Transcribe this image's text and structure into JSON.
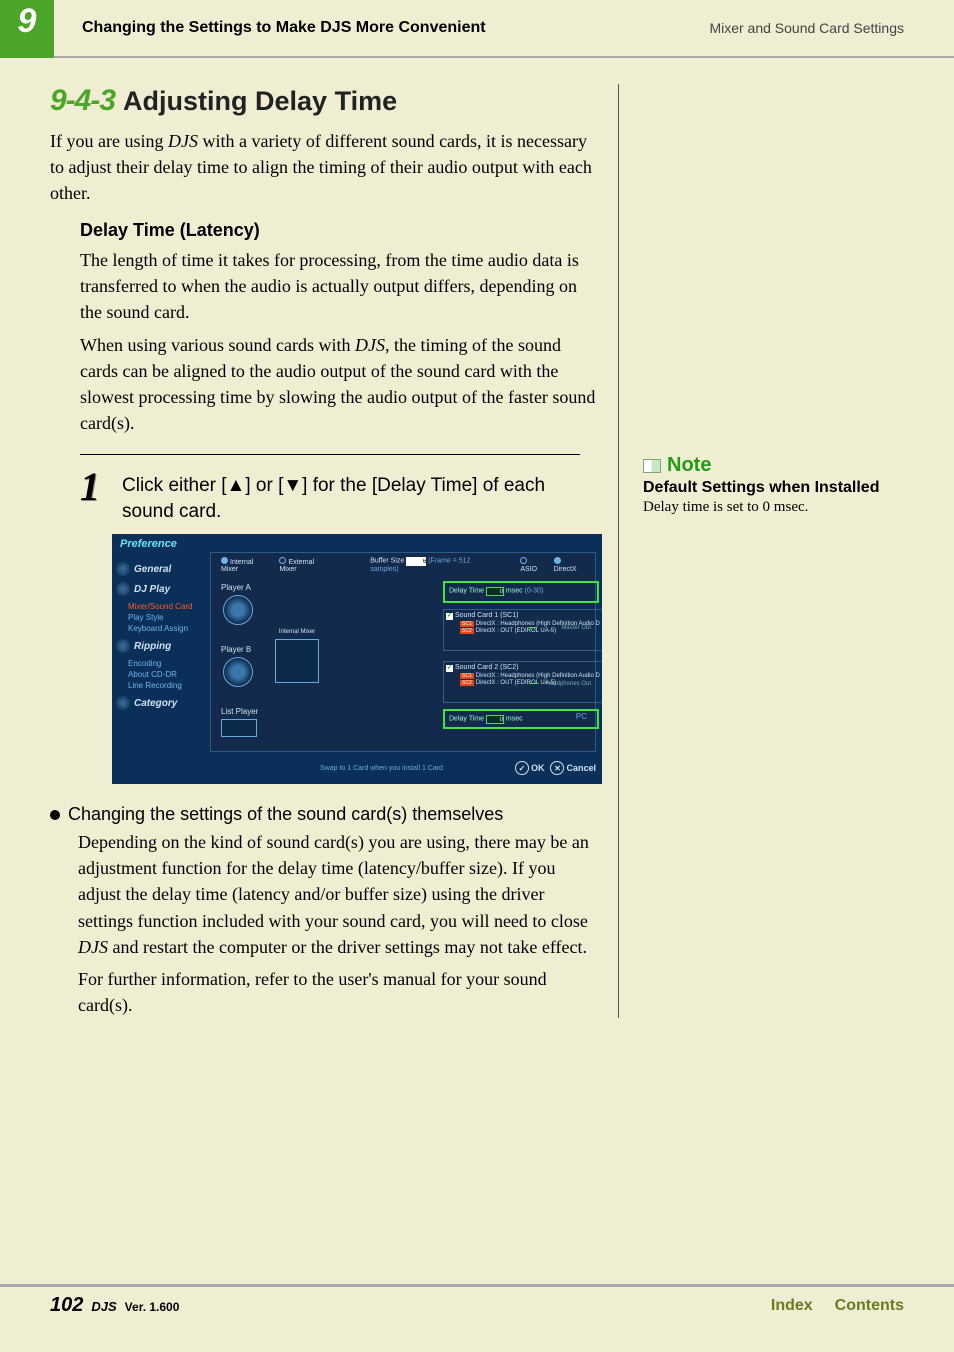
{
  "header": {
    "chapter_number": "9",
    "title": "Changing the Settings to Make DJS More Convenient",
    "subtitle": "Mixer and Sound Card Settings"
  },
  "section": {
    "number": "9-4-3",
    "title": "Adjusting Delay Time",
    "intro_before": "If you are using ",
    "intro_djs": "DJS",
    "intro_after": " with a variety of different sound cards, it is necessary to adjust their delay time to align the timing of their audio output with each other."
  },
  "latency": {
    "heading": "Delay Time (Latency)",
    "p1": "The length of time it takes for processing, from the time audio data is transferred to when the audio is actually output differs, depending on the sound card.",
    "p2_before": "When using various sound cards with ",
    "p2_djs": "DJS",
    "p2_after": ", the timing of the sound cards can be aligned to the audio output of the sound card with the slowest processing time by slowing the audio output of the faster sound card(s)."
  },
  "step": {
    "num": "1",
    "text": "Click either [▲] or [▼] for the [Delay Time] of each sound card."
  },
  "screenshot": {
    "title": "Preference",
    "sidebar": {
      "items": [
        "General",
        "DJ Play",
        "Ripping",
        "Category"
      ],
      "subs": {
        "djplay": [
          {
            "label": "Mixer/Sound Card",
            "active": true
          },
          {
            "label": "Play Style",
            "active": false
          },
          {
            "label": "Keyboard Assign",
            "active": false
          }
        ],
        "ripping": [
          {
            "label": "Encoding",
            "active": false
          },
          {
            "label": "About CD-DR",
            "active": false
          },
          {
            "label": "Line Recording",
            "active": false
          }
        ]
      }
    },
    "radios": {
      "internal": "Internal Mixer",
      "external": "External Mixer",
      "asio": "ASIO",
      "directx": "DirectX"
    },
    "buffer": {
      "label": "Buffer Size",
      "value": "6",
      "note": "(Frame = 512 samples)"
    },
    "delay_time": {
      "label": "Delay Time",
      "value": "0",
      "unit": "msec",
      "note": "(0-30)"
    },
    "delay_time_lp": {
      "label": "Delay Time",
      "value": "0",
      "unit": "msec"
    },
    "player_a": "Player A",
    "player_b": "Player B",
    "internal_mixer_label": "Internal Mixer",
    "list_player": "List Player",
    "sc1": {
      "title": "Sound Card 1 (SC1)",
      "line1_tag": "SC1",
      "line1": "DirectX : Headphones (High Definition Audio D",
      "line2_tag": "SC2",
      "line2": "DirectX : OUT (EDIROL UA-5)"
    },
    "sc2": {
      "title": "Sound Card 2 (SC2)",
      "line1_tag": "SC1",
      "line1": "DirectX : Headphones (High Definition Audio D",
      "line2_tag": "SC2",
      "line2": "DirectX : OUT (EDIROL UA-5)"
    },
    "out_master": "Master Out",
    "out_hp": "Headphones Out",
    "hint": "Swap to 1 Card when you install 1 Card",
    "pc": "PC",
    "ok": "OK",
    "cancel": "Cancel"
  },
  "bullet": {
    "heading": "Changing the settings of the sound card(s) themselves",
    "p1_before": "Depending on the kind of sound card(s) you are using, there may be an adjustment function for the delay time (latency/buffer size). If you adjust the delay time (latency and/or buffer size) using the driver settings function included with your sound card, you will need to close ",
    "p1_djs": "DJS",
    "p1_after": " and restart the computer or the driver settings may not take effect.",
    "p2": "For further information, refer to the user's manual for your sound card(s)."
  },
  "note": {
    "label": "Note",
    "heading": "Default Settings when Installed",
    "body": "Delay time is set to 0 msec."
  },
  "footer": {
    "page": "102",
    "djs": "DJS",
    "ver": "Ver. 1.600",
    "index": "Index",
    "contents": "Contents"
  }
}
